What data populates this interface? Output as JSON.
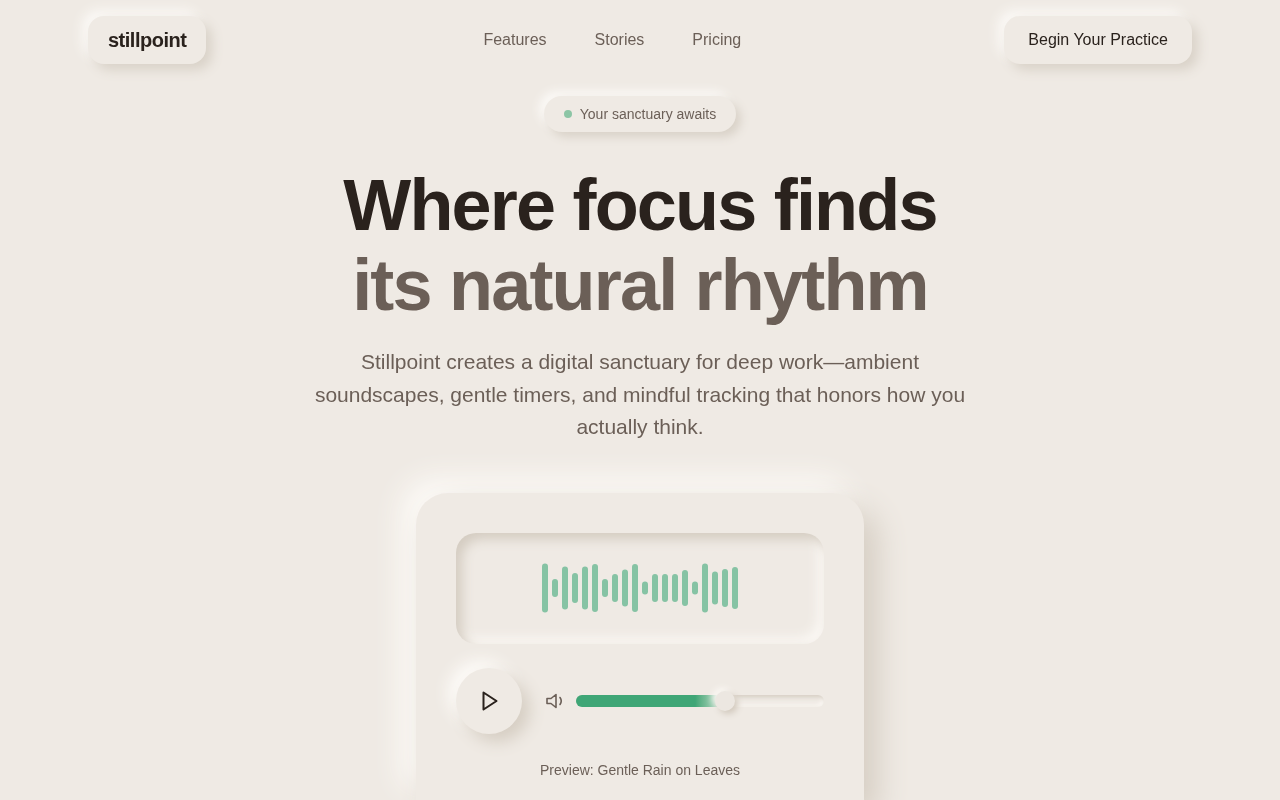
{
  "nav": {
    "logo": "stillpoint",
    "links": [
      "Features",
      "Stories",
      "Pricing"
    ],
    "cta": "Begin Your Practice"
  },
  "hero": {
    "badge": "Your sanctuary awaits",
    "headline": "Where focus finds",
    "headline_accent": "its natural rhythm",
    "description": "Stillpoint creates a digital sanctuary for deep work—ambient soundscapes, gentle timers, and mindful tracking that honors how you actually think."
  },
  "player": {
    "volume": {
      "level": 0.6
    },
    "caption": "Preview: Gentle Rain on Leaves"
  }
}
